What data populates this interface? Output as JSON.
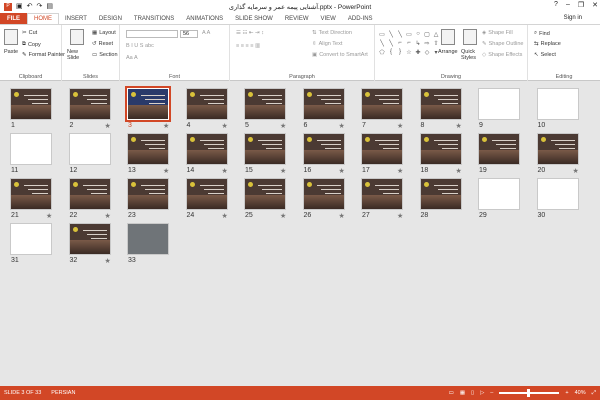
{
  "titlebar": {
    "title": "آشنایی پیمه عمر و سرمایه گذاری.pptx - PowerPoint",
    "help": "?",
    "minimize": "–",
    "restore": "❐",
    "close": "✕"
  },
  "tabs": {
    "file": "FILE",
    "items": [
      "HOME",
      "INSERT",
      "DESIGN",
      "TRANSITIONS",
      "ANIMATIONS",
      "SLIDE SHOW",
      "REVIEW",
      "VIEW",
      "ADD-INS"
    ],
    "signin": "Sign in"
  },
  "ribbon": {
    "clipboard": {
      "label": "Clipboard",
      "paste": "Paste",
      "cut": "Cut",
      "copy": "Copy",
      "format_painter": "Format Painter"
    },
    "slides": {
      "label": "Slides",
      "new_slide": "New Slide",
      "layout": "Layout",
      "reset": "Reset",
      "section": "Section"
    },
    "font": {
      "label": "Font",
      "size": "56"
    },
    "paragraph": {
      "label": "Paragraph",
      "text_direction": "Text Direction",
      "align_text": "Align Text",
      "convert": "Convert to SmartArt"
    },
    "drawing": {
      "label": "Drawing",
      "arrange": "Arrange",
      "quick_styles": "Quick Styles",
      "shape_fill": "Shape Fill",
      "shape_outline": "Shape Outline",
      "shape_effects": "Shape Effects"
    },
    "editing": {
      "label": "Editing",
      "find": "Find",
      "replace": "Replace",
      "select": "Select"
    }
  },
  "slides": [
    {
      "n": "1",
      "star": ""
    },
    {
      "n": "2",
      "star": "★"
    },
    {
      "n": "3",
      "star": "★"
    },
    {
      "n": "4",
      "star": "★"
    },
    {
      "n": "5",
      "star": "★"
    },
    {
      "n": "6",
      "star": "★"
    },
    {
      "n": "7",
      "star": "★"
    },
    {
      "n": "8",
      "star": "★"
    },
    {
      "n": "9",
      "star": ""
    },
    {
      "n": "10",
      "star": ""
    },
    {
      "n": "11",
      "star": ""
    },
    {
      "n": "12",
      "star": ""
    },
    {
      "n": "13",
      "star": "★"
    },
    {
      "n": "14",
      "star": "★"
    },
    {
      "n": "15",
      "star": "★"
    },
    {
      "n": "16",
      "star": "★"
    },
    {
      "n": "17",
      "star": "★"
    },
    {
      "n": "18",
      "star": "★"
    },
    {
      "n": "19",
      "star": ""
    },
    {
      "n": "20",
      "star": "★"
    },
    {
      "n": "21",
      "star": "★"
    },
    {
      "n": "22",
      "star": "★"
    },
    {
      "n": "23",
      "star": ""
    },
    {
      "n": "24",
      "star": "★"
    },
    {
      "n": "25",
      "star": "★"
    },
    {
      "n": "26",
      "star": "★"
    },
    {
      "n": "27",
      "star": "★"
    },
    {
      "n": "28",
      "star": ""
    },
    {
      "n": "29",
      "star": ""
    },
    {
      "n": "30",
      "star": ""
    },
    {
      "n": "31",
      "star": ""
    },
    {
      "n": "32",
      "star": "★"
    },
    {
      "n": "33",
      "star": ""
    }
  ],
  "statusbar": {
    "slide_info": "SLIDE 3 OF 33",
    "language": "PERSIAN",
    "zoom": "40%"
  },
  "colors": {
    "accent": "#d24726"
  }
}
